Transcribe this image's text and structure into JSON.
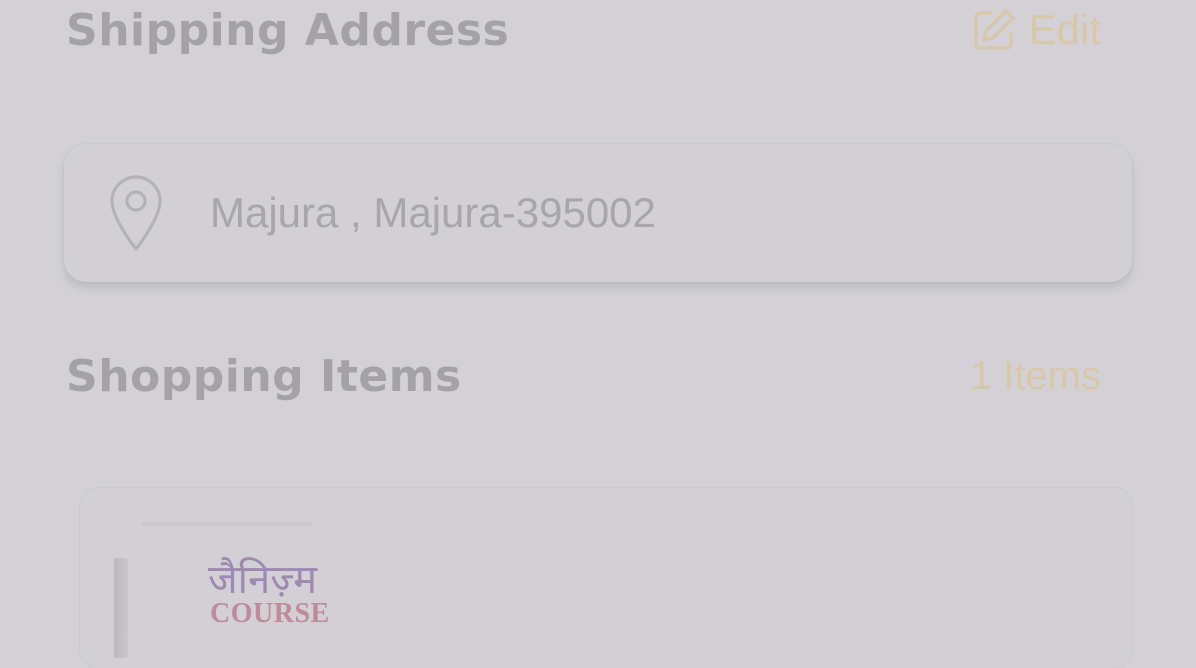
{
  "theme": {
    "accent": "#d8c7a8",
    "background": "#d3d1d5"
  },
  "shipping": {
    "title": "Shipping Address",
    "edit_label": "Edit",
    "edit_icon": "edit-icon",
    "address": "Majura , Majura-395002",
    "address_icon": "location-pin-icon"
  },
  "shopping": {
    "title": "Shopping Items",
    "count_label": "1 Items",
    "items": [
      {
        "thumbnail_title_hindi": "जैनिज़्म",
        "thumbnail_title_english": "COURSE"
      }
    ]
  }
}
